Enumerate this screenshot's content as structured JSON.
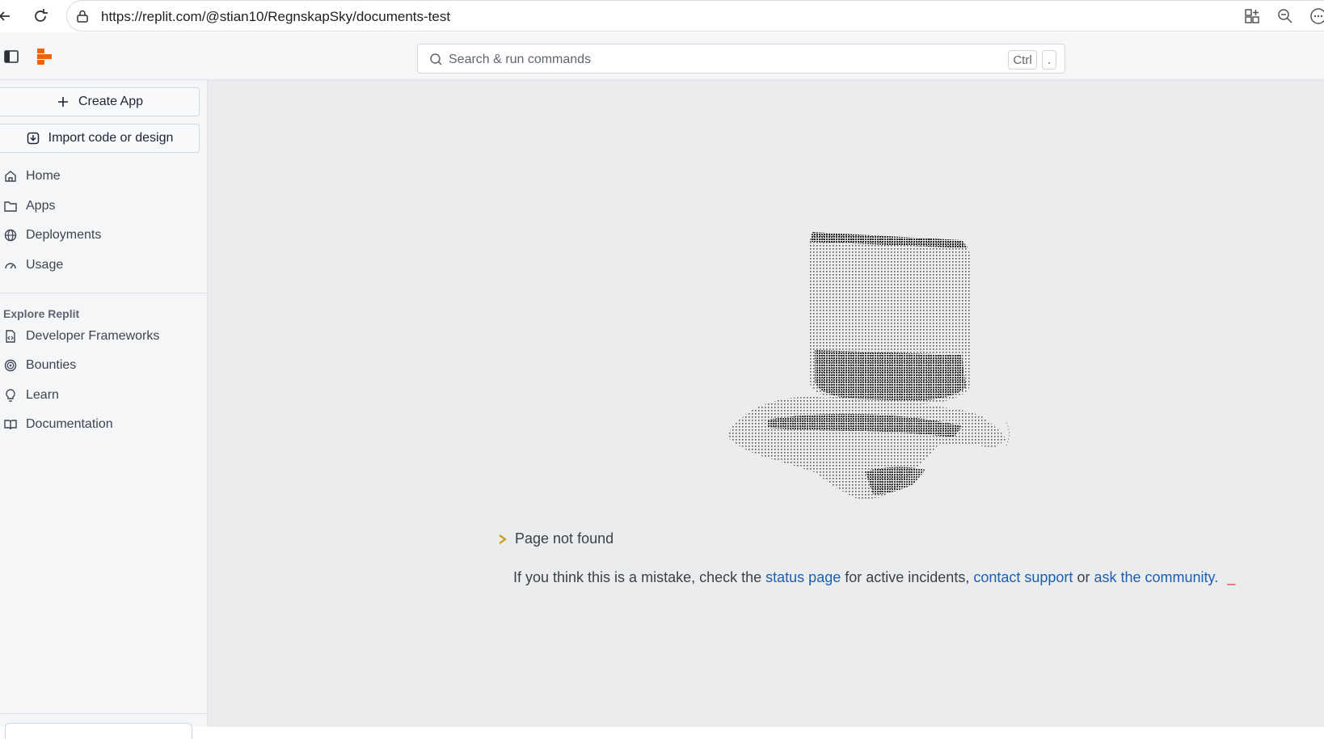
{
  "browser": {
    "url": "https://replit.com/@stian10/RegnskapSky/documents-test"
  },
  "header": {
    "search_placeholder": "Search & run commands",
    "shortcut_ctrl": "Ctrl",
    "shortcut_key": "."
  },
  "sidebar": {
    "create_app": "Create App",
    "import_code": "Import code or design",
    "items": [
      {
        "label": "Home",
        "icon": "home-icon"
      },
      {
        "label": "Apps",
        "icon": "folder-icon"
      },
      {
        "label": "Deployments",
        "icon": "globe-icon"
      },
      {
        "label": "Usage",
        "icon": "gauge-icon"
      }
    ],
    "explore_heading": "Explore Replit",
    "explore_items": [
      {
        "label": "Developer Frameworks",
        "icon": "code-file-icon"
      },
      {
        "label": "Bounties",
        "icon": "target-icon"
      },
      {
        "label": "Learn",
        "icon": "lightbulb-icon"
      },
      {
        "label": "Documentation",
        "icon": "book-icon"
      }
    ]
  },
  "main": {
    "title": "Page not found",
    "message_prefix": "If you think this is a mistake, check the",
    "status_link": "status page",
    "message_middle": "for active incidents,",
    "support_link": "contact support",
    "message_or": "or",
    "community_link": "ask the community.",
    "cursor": "_"
  },
  "colors": {
    "brand": "#f26207",
    "link": "#1a5fb4",
    "sidebar_bg": "#f5f6f7",
    "main_bg": "#ebeced"
  }
}
